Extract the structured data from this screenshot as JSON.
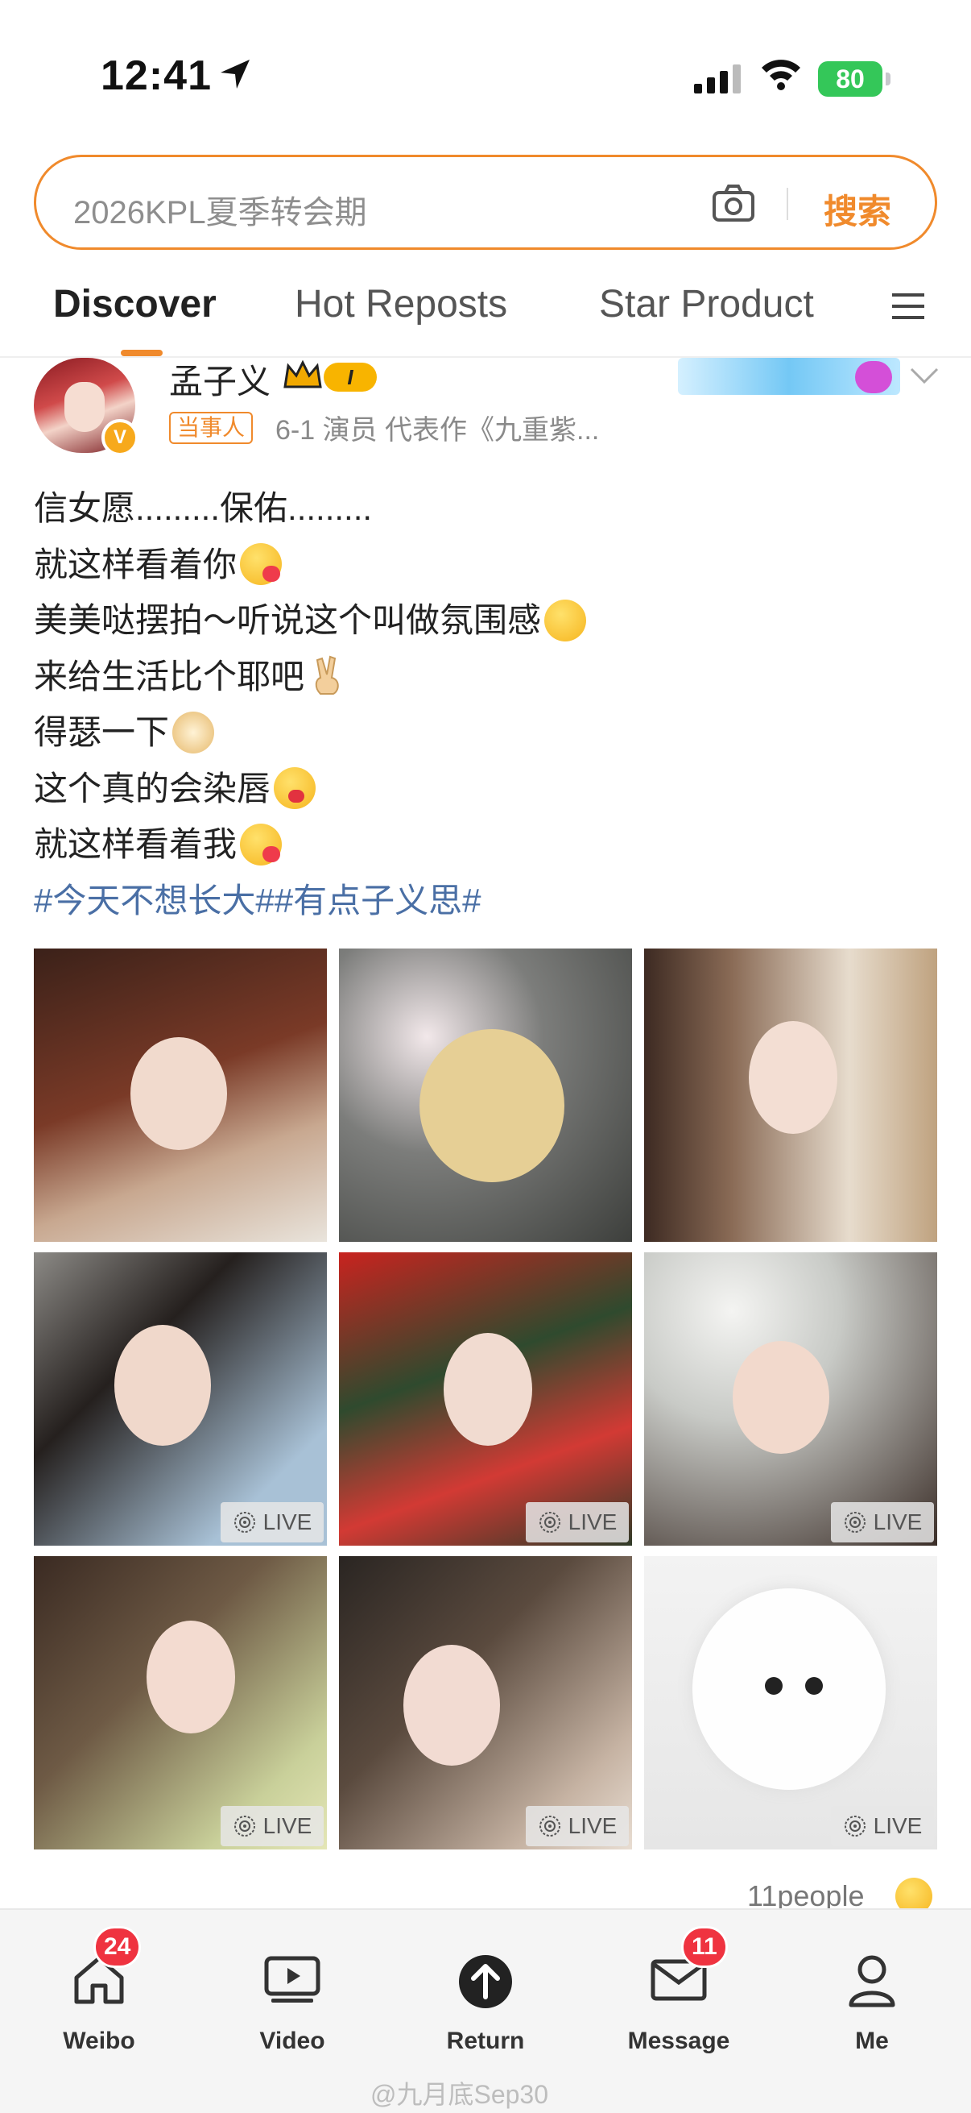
{
  "status_bar": {
    "time": "12:41",
    "battery": "80"
  },
  "search": {
    "placeholder": "2026KPL夏季转会期",
    "button": "搜索"
  },
  "tabs": [
    {
      "label": "Discover",
      "active": true
    },
    {
      "label": "Hot Reposts",
      "active": false
    },
    {
      "label": "Star Product",
      "active": false
    }
  ],
  "post": {
    "username": "孟子义",
    "level_badge": "I",
    "verified_badge": "V",
    "role_badge": "当事人",
    "meta": "6-1  演员 代表作《九重紫...",
    "lines": [
      "信女愿.........保佑.........",
      " 就这样看着你",
      " 美美哒摆拍～听说这个叫做氛围感",
      " 来给生活比个耶吧",
      " 得瑟一下",
      " 这个真的会染唇",
      " 就这样看着我"
    ],
    "hashtags": "#今天不想长大##有点子义思#",
    "photos": [
      {
        "live": false
      },
      {
        "live": false
      },
      {
        "live": false
      },
      {
        "live": true
      },
      {
        "live": true
      },
      {
        "live": true
      },
      {
        "live": true
      },
      {
        "live": true
      },
      {
        "live": true
      }
    ],
    "live_label": "LIVE",
    "likes_text": "11people"
  },
  "tabbar": {
    "items": [
      {
        "label": "Weibo",
        "badge": "24",
        "icon": "home-icon"
      },
      {
        "label": "Video",
        "badge": "",
        "icon": "video-icon"
      },
      {
        "label": "Return",
        "badge": "",
        "icon": "arrow-up-icon"
      },
      {
        "label": "Message",
        "badge": "11",
        "icon": "mail-icon"
      },
      {
        "label": "Me",
        "badge": "",
        "icon": "person-icon"
      }
    ]
  },
  "watermark": "@九月底Sep30",
  "colors": {
    "accent": "#f08a2c",
    "hashtag": "#4a6fa5",
    "badge_red": "#ef3340"
  }
}
